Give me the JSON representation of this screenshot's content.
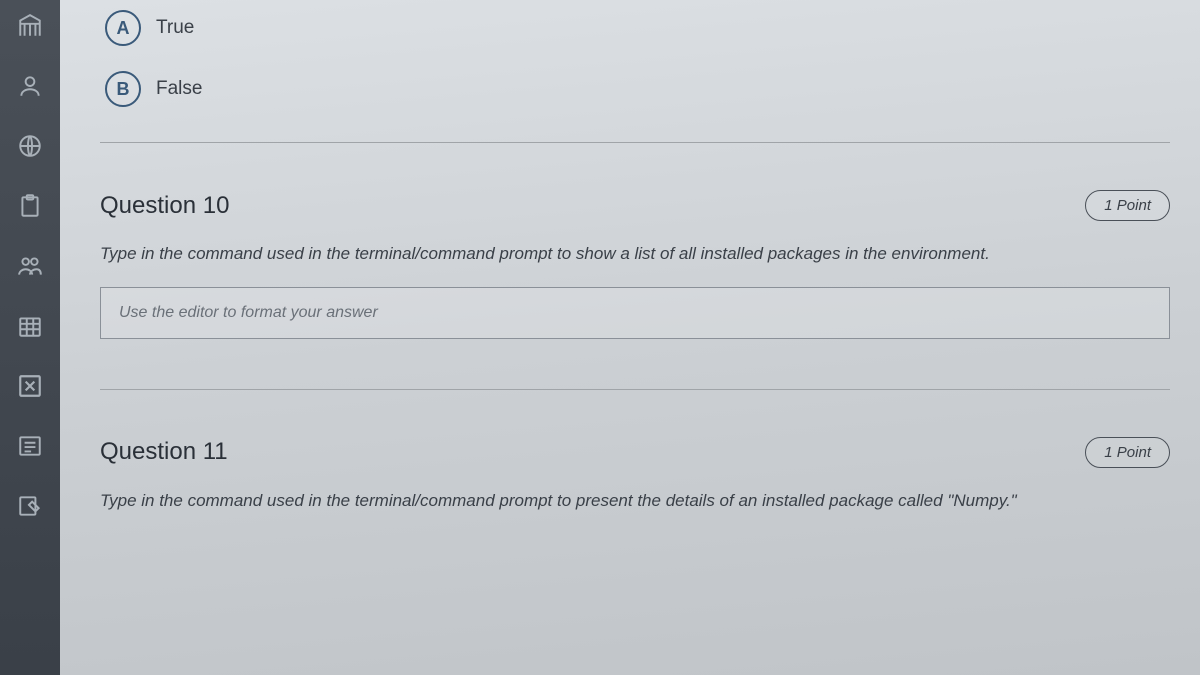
{
  "question9": {
    "options": [
      {
        "letter": "A",
        "label": "True"
      },
      {
        "letter": "B",
        "label": "False"
      }
    ]
  },
  "question10": {
    "title": "Question 10",
    "points": "1 Point",
    "text": "Type in the command used in the terminal/command prompt to show a list of all installed packages in the environment.",
    "editor_placeholder": "Use the editor to format your answer"
  },
  "question11": {
    "title": "Question 11",
    "points": "1 Point",
    "text": "Type in the command used in the terminal/command prompt to present the details of an installed package called \"Numpy.\""
  },
  "sidebar": {
    "icons": [
      "library",
      "person",
      "globe",
      "clipboard",
      "people",
      "calendar-grid",
      "close-x",
      "list",
      "edit"
    ]
  }
}
